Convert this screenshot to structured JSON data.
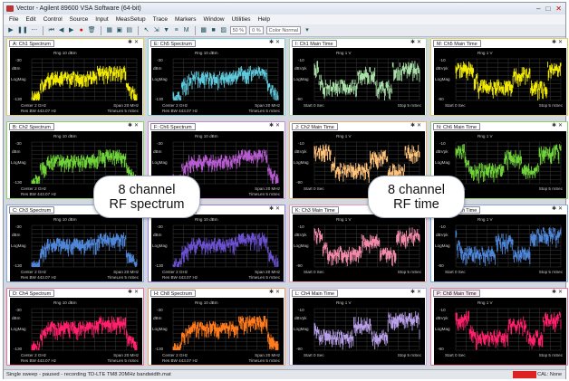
{
  "window": {
    "title": "Vector - Agilent 89600 VSA Software (64-bit)",
    "controls": [
      "–",
      "□",
      "✕"
    ]
  },
  "menu": [
    "File",
    "Edit",
    "Control",
    "Source",
    "Input",
    "MeasSetup",
    "Trace",
    "Markers",
    "Window",
    "Utilities",
    "Help"
  ],
  "toolbar": {
    "zoom_a": "50 %",
    "zoom_b": "0 %",
    "color_mode": "Color Normal"
  },
  "panes": [
    {
      "title": "A: Ch1 Spectrum",
      "kind": "spectrum",
      "color": "#f2ea00",
      "border": "#d8d060",
      "ref": "Rng 10 dBm",
      "ticks": [
        "-30",
        "-130"
      ],
      "unit": "dBm",
      "fmt": "LogMag",
      "bl": [
        "Center 2 GHz",
        "Res BW 443.07 Hz"
      ],
      "br": [
        "Span 20 MHz",
        "TimeLen 5 mSec"
      ]
    },
    {
      "title": "E: Ch5 Spectrum",
      "kind": "spectrum",
      "color": "#5fc9dc",
      "border": "#7fcfd9",
      "ref": "Rng 10 dBm",
      "ticks": [
        "-30",
        "-130"
      ],
      "unit": "dBm",
      "fmt": "LogMag",
      "bl": [
        "Center 2 GHz",
        "Res BW 443.07 Hz"
      ],
      "br": [
        "Span 20 MHz",
        "TimeLen 5 mSec"
      ]
    },
    {
      "title": "I: Ch1 Main Time",
      "kind": "time",
      "color": "#a8e0a8",
      "border": "#b0d8b0",
      "ref": "Rng 1 V",
      "ticks": [
        "-10",
        "-90"
      ],
      "unit": "dBVpk",
      "fmt": "LogMag",
      "bl": [
        "Start 0  Sec"
      ],
      "br": [
        "Stop 5 mSec"
      ]
    },
    {
      "title": "M: Ch5 Main Time",
      "kind": "time",
      "color": "#f2ea00",
      "border": "#d8d060",
      "ref": "Rng 1 V",
      "ticks": [
        "-10",
        "-90"
      ],
      "unit": "dBVpk",
      "fmt": "LogMag",
      "bl": [
        "Start 0  Sec"
      ],
      "br": [
        "Stop 5 mSec"
      ]
    },
    {
      "title": "B: Ch2 Spectrum",
      "kind": "spectrum",
      "color": "#6fd238",
      "border": "#8bd068",
      "ref": "Rng 10 dBm",
      "ticks": [
        "-30",
        "-130"
      ],
      "unit": "dBm",
      "fmt": "LogMag",
      "bl": [
        "Center 2 GHz",
        "Res BW 443.07 Hz"
      ],
      "br": [
        "Span 20 MHz",
        "TimeLen 5 mSec"
      ]
    },
    {
      "title": "F: Ch6 Spectrum",
      "kind": "spectrum",
      "color": "#b65bcf",
      "border": "#c98ad8",
      "ref": "Rng 10 dBm",
      "ticks": [
        "-30",
        "-130"
      ],
      "unit": "dBm",
      "fmt": "LogMag",
      "bl": [
        "Center 2 GHz",
        "Res BW 443.07 Hz"
      ],
      "br": [
        "Span 20 MHz",
        "TimeLen 5 mSec"
      ]
    },
    {
      "title": "J: Ch2 Main Time",
      "kind": "time",
      "color": "#ffc27a",
      "border": "#e8b880",
      "ref": "Rng 1 V",
      "ticks": [
        "-10",
        "-90"
      ],
      "unit": "dBVpk",
      "fmt": "LogMag",
      "bl": [
        "Start 0  Sec"
      ],
      "br": [
        "Stop 5 mSec"
      ]
    },
    {
      "title": "N: Ch6 Main Time",
      "kind": "time",
      "color": "#6fd238",
      "border": "#8bd068",
      "ref": "Rng 1 V",
      "ticks": [
        "-10",
        "-90"
      ],
      "unit": "dBVpk",
      "fmt": "LogMag",
      "bl": [
        "Start 0  Sec"
      ],
      "br": [
        "Stop 5 mSec"
      ]
    },
    {
      "title": "C: Ch3 Spectrum",
      "kind": "spectrum",
      "color": "#4f86d8",
      "border": "#7ea6de",
      "ref": "Rng 10 dBm",
      "ticks": [
        "-30",
        "-130"
      ],
      "unit": "dBm",
      "fmt": "LogMag",
      "bl": [
        "Center 2 GHz",
        "Res BW 443.07 Hz"
      ],
      "br": [
        "Span 20 MHz",
        "TimeLen 5 mSec"
      ]
    },
    {
      "title": "G: Ch7 Spectrum",
      "kind": "spectrum",
      "color": "#6a4fcf",
      "border": "#8f7fd8",
      "ref": "Rng 10 dBm",
      "ticks": [
        "-30",
        "-130"
      ],
      "unit": "dBm",
      "fmt": "LogMag",
      "bl": [
        "Center 2 GHz",
        "Res BW 443.07 Hz"
      ],
      "br": [
        "Span 20 MHz",
        "TimeLen 5 mSec"
      ]
    },
    {
      "title": "K: Ch3 Main Time",
      "kind": "time",
      "color": "#f08aa8",
      "border": "#e8a0b8",
      "ref": "Rng 1 V",
      "ticks": [
        "-10",
        "-90"
      ],
      "unit": "dBVpk",
      "fmt": "LogMag",
      "bl": [
        "Start 0  Sec"
      ],
      "br": [
        "Stop 5 mSec"
      ]
    },
    {
      "title": "O: Ch7 Main Time",
      "kind": "time",
      "color": "#4f86d8",
      "border": "#7ea6de",
      "ref": "Rng 1 V",
      "ticks": [
        "-10",
        "-90"
      ],
      "unit": "dBVpk",
      "fmt": "LogMag",
      "bl": [
        "Start 0  Sec"
      ],
      "br": [
        "Stop 5 mSec"
      ]
    },
    {
      "title": "D: Ch4 Spectrum",
      "kind": "spectrum",
      "color": "#ff1f6a",
      "border": "#e87098",
      "ref": "Rng 10 dBm",
      "ticks": [
        "-30",
        "-130"
      ],
      "unit": "dBm",
      "fmt": "LogMag",
      "bl": [
        "Center 2 GHz",
        "Res BW 443.07 Hz"
      ],
      "br": [
        "Span 20 MHz",
        "TimeLen 5 mSec"
      ]
    },
    {
      "title": "H: Ch8 Spectrum",
      "kind": "spectrum",
      "color": "#ff7a1a",
      "border": "#e8a070",
      "ref": "Rng 10 dBm",
      "ticks": [
        "-30",
        "-130"
      ],
      "unit": "dBm",
      "fmt": "LogMag",
      "bl": [
        "Center 2 GHz",
        "Res BW 443.07 Hz"
      ],
      "br": [
        "Span 20 MHz",
        "TimeLen 5 mSec"
      ]
    },
    {
      "title": "L: Ch4 Main Time",
      "kind": "time",
      "color": "#b7a0e8",
      "border": "#c0b0e0",
      "ref": "Rng 1 V",
      "ticks": [
        "-10",
        "-90"
      ],
      "unit": "dBVpk",
      "fmt": "LogMag",
      "bl": [
        "Start 0  Sec"
      ],
      "br": [
        "Stop 5 mSec"
      ]
    },
    {
      "title": "P: Ch8 Main Time",
      "kind": "time",
      "color": "#ff1f6a",
      "border": "#e87098",
      "ref": "Rng 1 V",
      "ticks": [
        "-10",
        "-90"
      ],
      "unit": "dBVpk",
      "fmt": "LogMag",
      "bl": [
        "Start 0  Sec"
      ],
      "br": [
        "Stop 5 mSec"
      ]
    }
  ],
  "callouts": {
    "left": "8 channel\nRF spectrum",
    "right": "8 channel\nRF time"
  },
  "status": {
    "text": "Single sweep - paused - recording TD-LTE TM8 20MHz bandwidth.mat",
    "cal": "CAL: None"
  }
}
